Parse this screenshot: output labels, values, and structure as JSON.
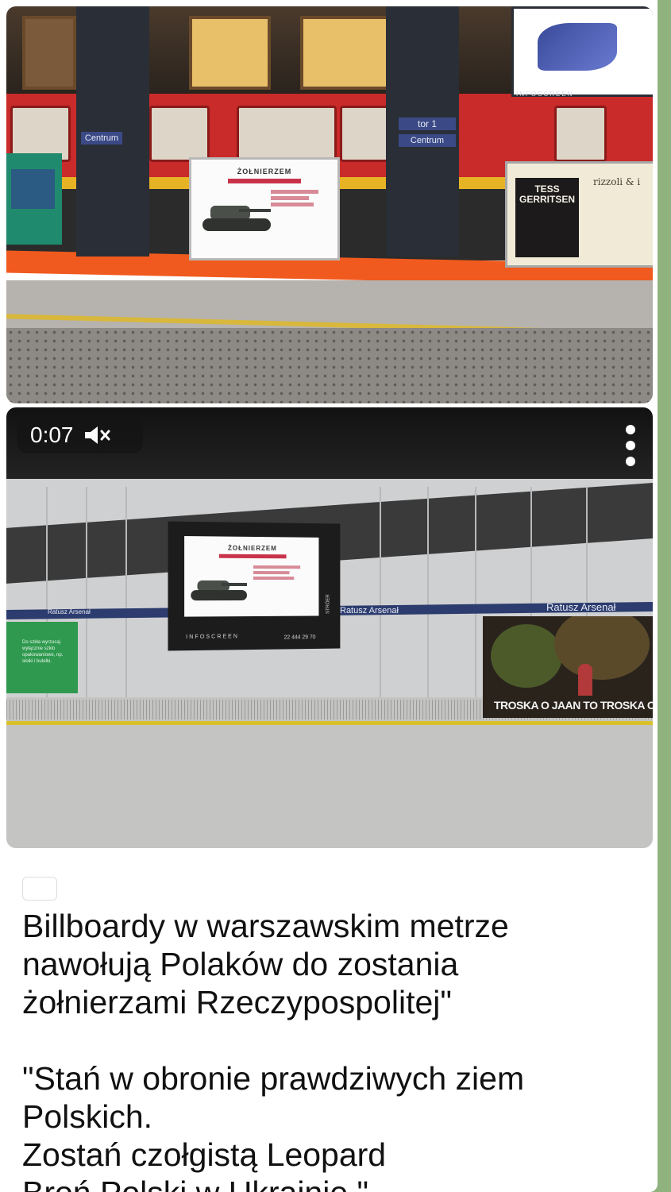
{
  "message": {
    "photo1": {
      "station_sign_left": "Centrum",
      "track_sign_line1": "tor 1",
      "track_sign_line2": "Centrum",
      "billboard_title": "ŻOŁNIERZEM",
      "screen_label": "INFOSCREEN",
      "book_author_line1": "TESS",
      "book_author_line2": "GERRITSEN",
      "book_series": "rizzoli & i"
    },
    "video": {
      "timer": "0:07",
      "station_name": "Ratusz Arsenał",
      "station_name_small": "Ratusz Arsenał",
      "billboard_title": "ŻOŁNIERZEM",
      "frame_label": "INFOSCREEN",
      "frame_phone": "22 444 29 70",
      "frame_side_label": "STRÓER",
      "green_ad_text": "Do szkła wyrzucaj wyłącznie szkło opakowaniowe, np. słoiki i butelki.",
      "troska_text": "TROSKA O JAAN TO TROSKA O CIE",
      "muted": true
    },
    "caption": {
      "line1": "Billboardy w warszawskim metrze",
      "line2": "nawołują Polaków do zostania",
      "line3": "żołnierzami Rzeczypospolitej\"",
      "line4": "\"Stań w obronie prawdziwych ziem",
      "line5": "Polskich.",
      "line6": "Zostań czołgistą Leopard",
      "line7": "Broń Polski w Ukrainie.\""
    },
    "colors": {
      "chat_background": "#90b27f",
      "bubble": "#ffffff",
      "flag_red": "#dc143c"
    }
  }
}
